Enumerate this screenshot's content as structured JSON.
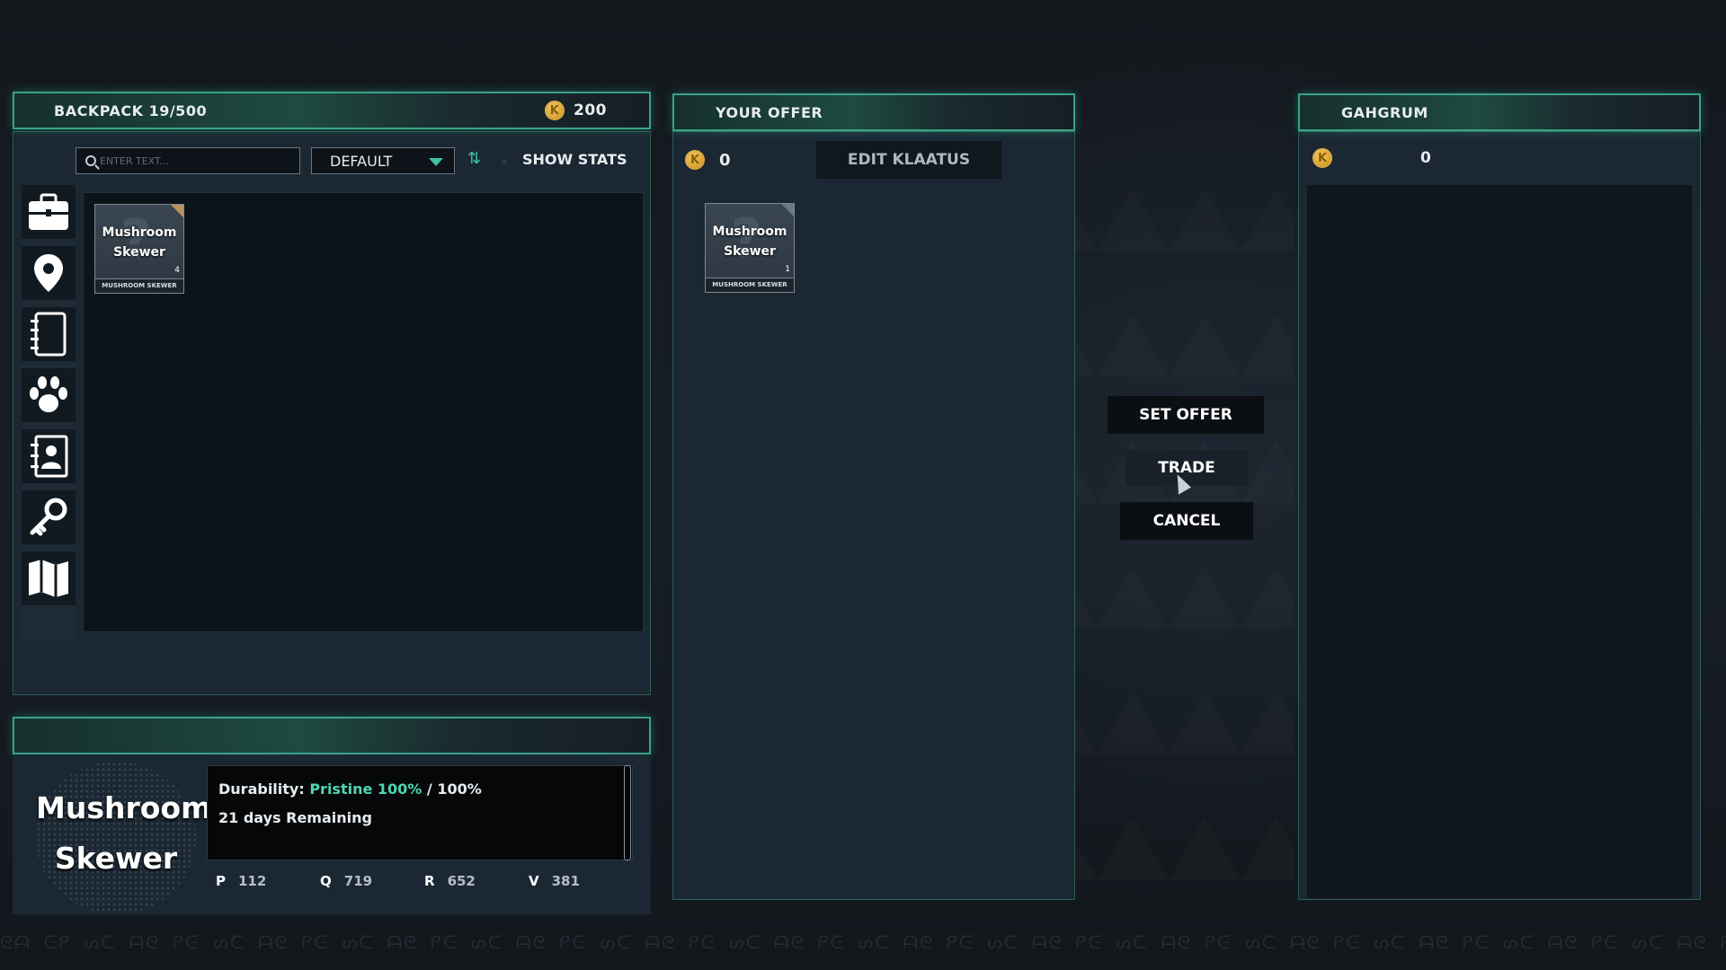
{
  "backpack": {
    "title": "BACKPACK 19/500",
    "coins": "200",
    "search_placeholder": "ENTER TEXT...",
    "sort_option": "DEFAULT",
    "show_stats_label": "SHOW STATS",
    "sidebar": [
      {
        "icon": "briefcase-icon"
      },
      {
        "icon": "map-pin-icon"
      },
      {
        "icon": "notebook-icon"
      },
      {
        "icon": "paw-icon"
      },
      {
        "icon": "contacts-icon"
      },
      {
        "icon": "key-icon"
      },
      {
        "icon": "map-icon"
      }
    ],
    "items": [
      {
        "name": "Mushroom Skewer",
        "qty": "4",
        "footer": "MUSHROOM SKEWER"
      }
    ]
  },
  "offer": {
    "title": "YOUR OFFER",
    "coins": "0",
    "edit_label": "EDIT KLAATUS",
    "items": [
      {
        "name": "Mushroom Skewer",
        "qty": "1",
        "footer": "MUSHROOM SKEWER"
      }
    ]
  },
  "actions": {
    "set_offer": "SET OFFER",
    "trade": "TRADE",
    "cancel": "CANCEL"
  },
  "merchant": {
    "title": "GAHGRUM",
    "coins": "0"
  },
  "details": {
    "item_name": "Mushroom Skewer",
    "durability_label": "Durability:",
    "durability_value": "Pristine 100%",
    "durability_max": "/ 100%",
    "remaining": "21 days Remaining",
    "stats": [
      {
        "label": "P",
        "value": "112"
      },
      {
        "label": "Q",
        "value": "719"
      },
      {
        "label": "R",
        "value": "652"
      },
      {
        "label": "V",
        "value": "381"
      }
    ]
  },
  "colors": {
    "accent": "#3ec2a0",
    "coin": "#e3b04a",
    "durability": "#4fd6b0"
  }
}
